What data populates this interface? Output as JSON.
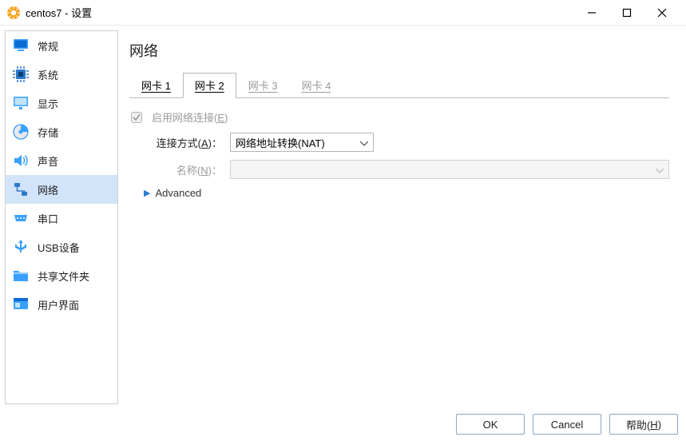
{
  "window": {
    "title": "centos7 - 设置"
  },
  "sidebar": {
    "items": [
      {
        "label": "常规"
      },
      {
        "label": "系统"
      },
      {
        "label": "显示"
      },
      {
        "label": "存储"
      },
      {
        "label": "声音"
      },
      {
        "label": "网络"
      },
      {
        "label": "串口"
      },
      {
        "label": "USB设备"
      },
      {
        "label": "共享文件夹"
      },
      {
        "label": "用户界面"
      }
    ]
  },
  "page": {
    "title": "网络"
  },
  "tabs": [
    {
      "prefix": "网卡 ",
      "num": "1"
    },
    {
      "prefix": "网卡 ",
      "num": "2"
    },
    {
      "prefix": "网卡 ",
      "num": "3"
    },
    {
      "prefix": "网卡 ",
      "num": "4"
    }
  ],
  "adapter": {
    "enable_prefix": "启用网络连接(",
    "enable_accel": "E",
    "enable_suffix": ")",
    "attached_prefix": "连接方式(",
    "attached_accel": "A",
    "attached_suffix": ")：",
    "attached_value": "网络地址转换(NAT)",
    "name_prefix": "名称(",
    "name_accel": "N",
    "name_suffix": ")：",
    "name_value": "",
    "advanced_label": "Advanced"
  },
  "footer": {
    "ok": "OK",
    "cancel": "Cancel",
    "help_prefix": "帮助(",
    "help_accel": "H",
    "help_suffix": ")"
  }
}
